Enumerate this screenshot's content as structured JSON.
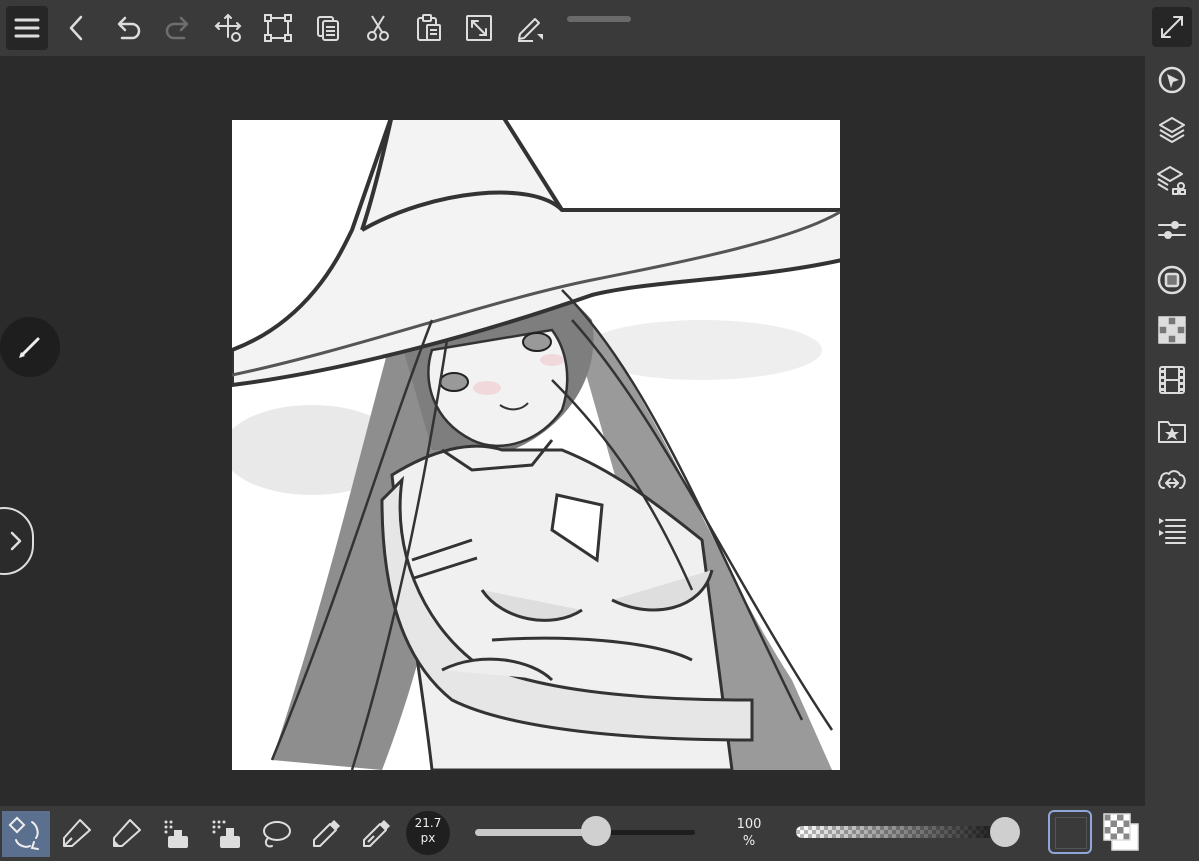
{
  "toolbar": {
    "items": [
      "menu-icon",
      "back-icon",
      "undo-icon",
      "redo-icon",
      "transform-move-icon",
      "crop-icon",
      "copy-icon",
      "cut-icon",
      "paste-icon",
      "fit-screen-icon",
      "pen-settings-icon"
    ]
  },
  "right_panel": {
    "items": [
      "fullscreen-icon",
      "navigator-icon",
      "layers-icon",
      "material-icon",
      "adjust-icon",
      "filter-icon",
      "tile-icon",
      "animation-icon",
      "favorites-icon",
      "share-icon",
      "layer-list-icon"
    ]
  },
  "bottom_tools": {
    "items": [
      "select-transform-icon",
      "pen-icon",
      "pencil-icon",
      "spray-icon",
      "airbrush-icon",
      "lasso-icon",
      "eyedropper-icon",
      "eyedropper-alt-icon"
    ],
    "active_index": 0
  },
  "brush": {
    "size_value": "21.7",
    "size_unit": "px",
    "size_fraction": 0.56
  },
  "opacity": {
    "value": "100",
    "unit": "%",
    "fraction": 1.0
  },
  "colors": {
    "panel": "#3a3a3a",
    "workspace": "#2b2b2b",
    "active_tool": "#5b6f8e",
    "swatch_border": "#8fa6d8"
  }
}
